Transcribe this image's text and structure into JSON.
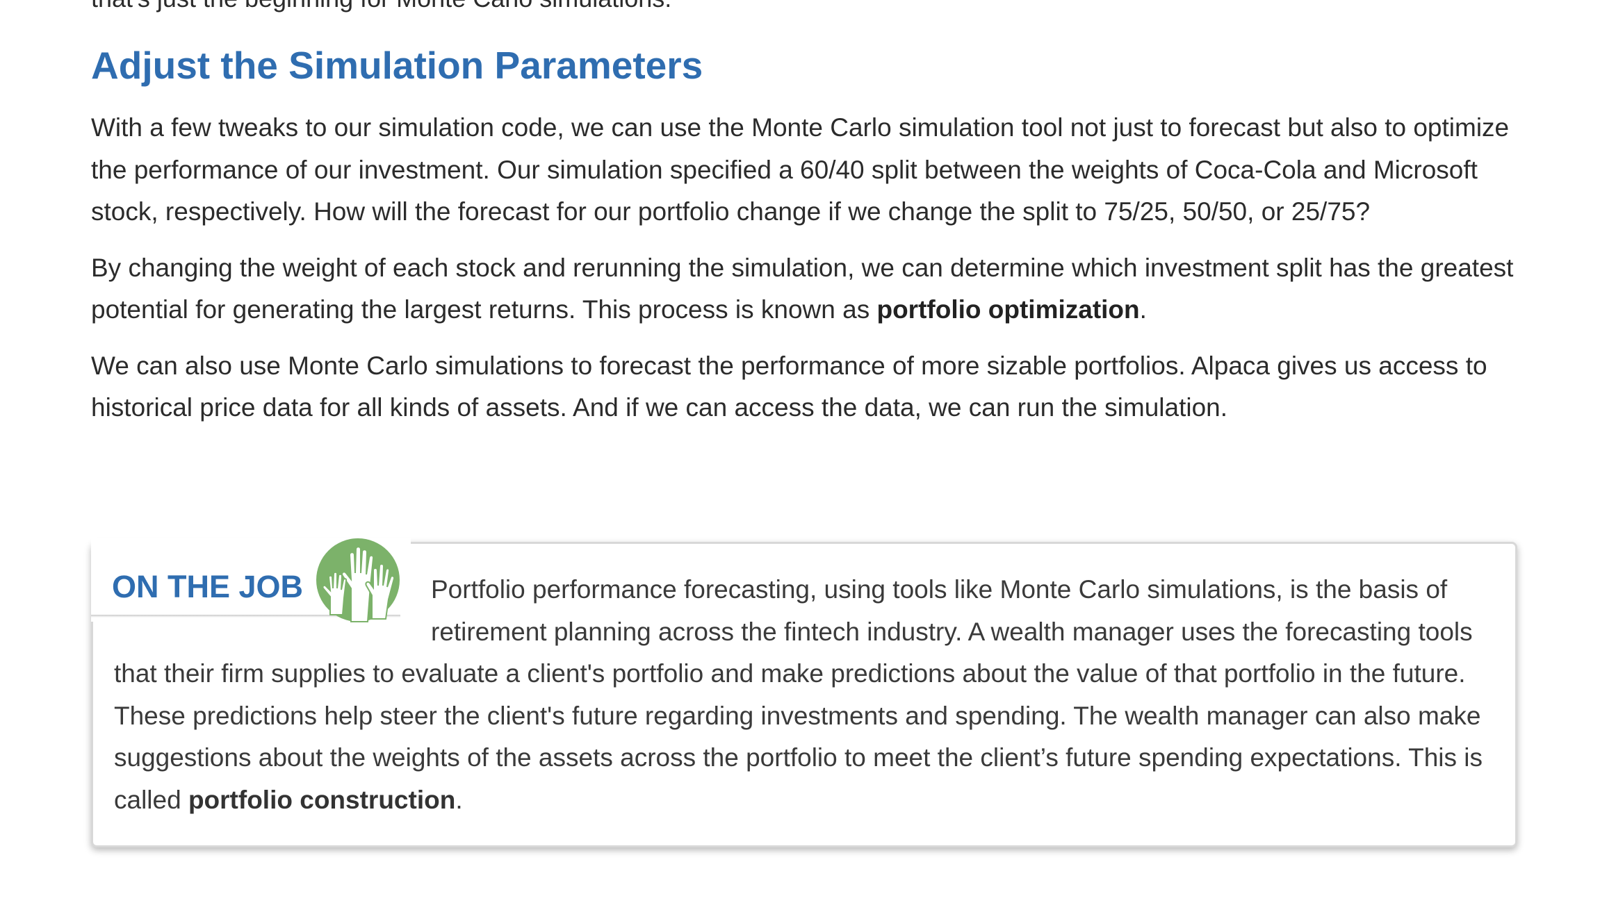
{
  "top_cut_line": "that's just the beginning for Monte Carlo simulations.",
  "heading": "Adjust the Simulation Parameters",
  "paragraph1": "With a few tweaks to our simulation code, we can use the Monte Carlo simulation tool not just to forecast but also to optimize the performance of our investment. Our simulation specified a 60/40 split between the weights of Coca-Cola and Microsoft stock, respectively. How will the forecast for our portfolio change if we change the split to 75/25, 50/50, or 25/75?",
  "paragraph2": {
    "text": "By changing the weight of each stock and rerunning the simulation, we can determine which investment split has the greatest potential for generating the largest returns. This process is known as ",
    "bold": "portfolio optimization",
    "end": "."
  },
  "paragraph3": "We can also use Monte Carlo simulations to forecast the performance of more sizable portfolios. Alpaca gives us access to historical price data for all kinds of assets. And if we can access the data, we can run the simulation.",
  "callout": {
    "label": "ON THE JOB",
    "icon": "raised-hands-icon",
    "text": "Portfolio performance forecasting, using tools like Monte Carlo simulations, is the basis of retirement planning across the fintech industry. A wealth manager uses the forecasting tools that their firm supplies to evaluate a client's portfolio and make predictions about the value of that portfolio in the future. These predictions help steer the client's future regarding investments and spending. The wealth manager can also make suggestions about the weights of the assets across the portfolio to meet the client’s future spending expectations. This is called ",
    "bold": "portfolio construction",
    "end": "."
  },
  "colors": {
    "heading": "#2f6db0",
    "body_text": "#2b2b2b",
    "icon_green": "#7cb26a"
  }
}
